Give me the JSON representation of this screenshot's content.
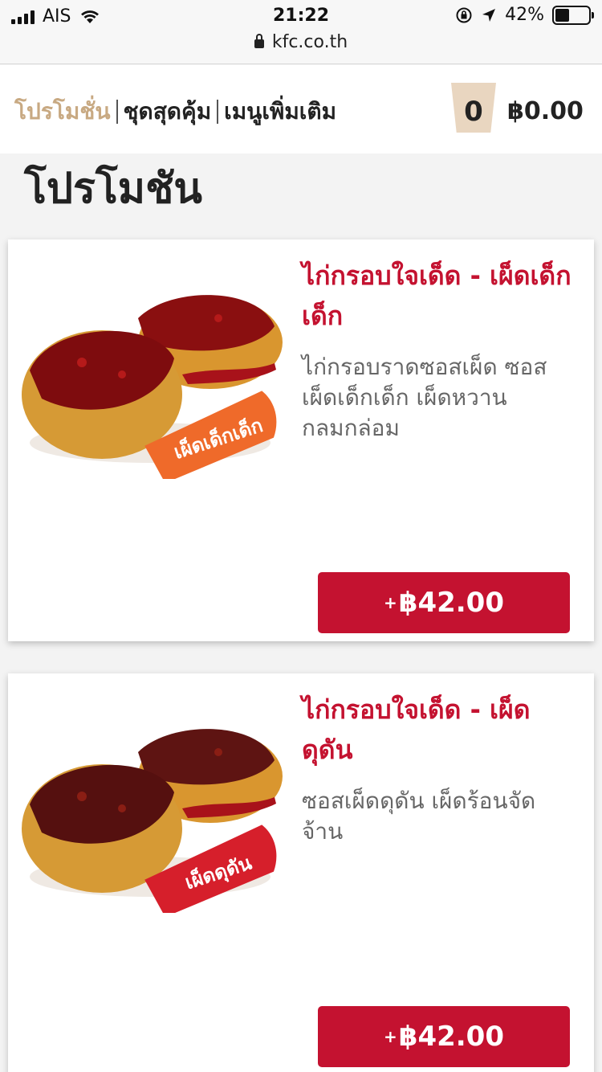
{
  "status_bar": {
    "carrier": "AIS",
    "time": "21:22",
    "battery": "42%",
    "battery_level": 0.42,
    "url": "kfc.co.th"
  },
  "nav": {
    "items": [
      {
        "label": "โปรโมชั่น",
        "active": true
      },
      {
        "label": "ชุดสุดคุ้ม",
        "active": false
      },
      {
        "label": "เมนูเพิ่มเติม",
        "active": false
      }
    ]
  },
  "cart": {
    "count": "0",
    "total": "฿0.00"
  },
  "page_title": "โปรโมชัน",
  "products": [
    {
      "title": "ไก่กรอบใจเด็ด - เผ็ดเด็กเด็ก",
      "description": "ไก่กรอบราดซอสเผ็ด ซอสเผ็ดเด็กเด็ก เผ็ดหวานกลมกล่อม",
      "badge": "เผ็ดเด็กเด็ก",
      "plus": "+",
      "price": "฿42.00",
      "badge_color": "#ef6a2a"
    },
    {
      "title": "ไก่กรอบใจเด็ด - เผ็ดดุดัน",
      "description": "ซอสเผ็ดดุดัน เผ็ดร้อนจัดจ้าน",
      "badge": "เผ็ดดุดัน",
      "plus": "+",
      "price": "฿42.00",
      "badge_color": "#d61f2b"
    }
  ],
  "colors": {
    "brand_red": "#c41230",
    "nav_active": "#c8a982"
  }
}
